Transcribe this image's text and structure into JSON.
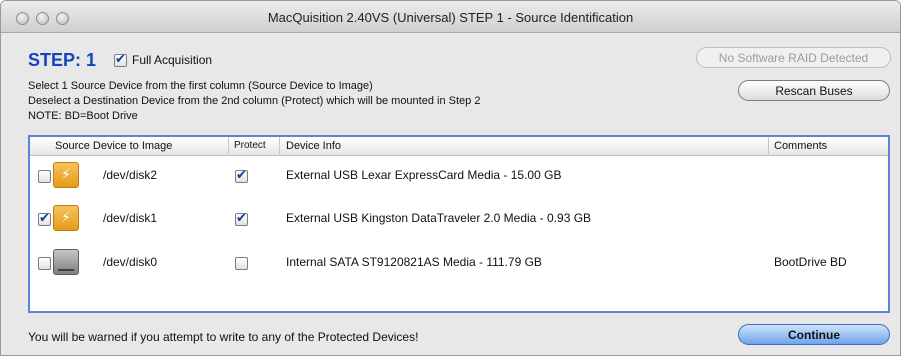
{
  "window": {
    "title": "MacQuisition 2.40VS (Universal)  STEP 1 - Source Identification"
  },
  "step": {
    "label": "STEP: 1",
    "full_acquisition": {
      "label": "Full Acquisition",
      "checked": true
    }
  },
  "raid_status": "No Software RAID Detected",
  "instructions": [
    "Select 1 Source Device from the first column (Source Device to Image)",
    "Deselect a Destination Device from the 2nd column (Protect) which will be mounted in Step 2",
    "NOTE: BD=Boot Drive"
  ],
  "rescan_button": "Rescan Buses",
  "table": {
    "headers": {
      "source": "Source Device to Image",
      "protect": "Protect",
      "info": "Device Info",
      "comments": "Comments"
    },
    "rows": [
      {
        "selected": false,
        "icon": "usb-drive-icon",
        "device": "/dev/disk2",
        "protect": true,
        "info": "External USB Lexar ExpressCard Media - 15.00 GB",
        "comment": ""
      },
      {
        "selected": true,
        "icon": "usb-drive-icon",
        "device": "/dev/disk1",
        "protect": true,
        "info": "External USB Kingston DataTraveler 2.0 Media - 0.93 GB",
        "comment": ""
      },
      {
        "selected": false,
        "icon": "hard-drive-icon",
        "device": "/dev/disk0",
        "protect": false,
        "info": "Internal SATA ST9120821AS Media - 111.79 GB",
        "comment": "BootDrive BD"
      }
    ]
  },
  "footer_note": "You will be warned if you attempt to write to any of the Protected Devices!",
  "continue_button": "Continue",
  "colors": {
    "step_blue": "#1444c6",
    "table_border": "#5b86d8",
    "continue_button": "#6ea3ec"
  }
}
